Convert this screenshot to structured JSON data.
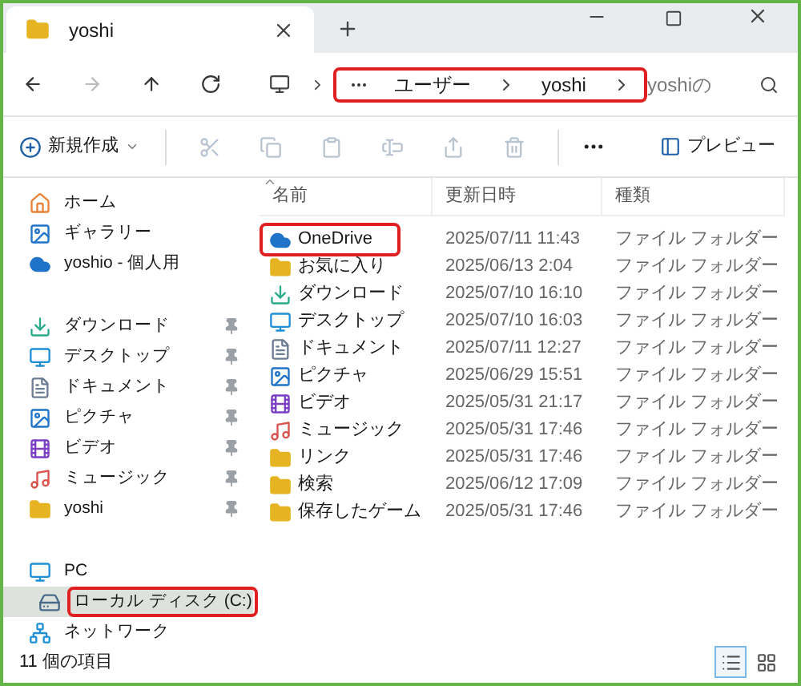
{
  "tab": {
    "title": "yoshi",
    "selected": true
  },
  "breadcrumb": {
    "segments": [
      "ユーザー",
      "yoshi"
    ],
    "annotated": true
  },
  "search": {
    "placeholder": "yoshiの"
  },
  "toolbar": {
    "new_label": "新規作成",
    "actions": [
      {
        "kind": "cut",
        "disabled": true
      },
      {
        "kind": "copy",
        "disabled": true
      },
      {
        "kind": "paste",
        "disabled": true
      },
      {
        "kind": "rename",
        "disabled": true
      },
      {
        "kind": "share",
        "disabled": true
      },
      {
        "kind": "delete",
        "disabled": true
      }
    ],
    "preview_label": "プレビュー"
  },
  "sidebar": {
    "groups": [
      [
        {
          "label": "ホーム",
          "kind": "home",
          "selected": false,
          "annotated": false
        },
        {
          "label": "ギャラリー",
          "kind": "picture",
          "selected": false,
          "annotated": false
        },
        {
          "label": "yoshio - 個人用",
          "kind": "cloud",
          "selected": false,
          "annotated": false
        }
      ],
      [
        {
          "label": "ダウンロード",
          "kind": "download",
          "pinned": true,
          "selected": false,
          "annotated": false
        },
        {
          "label": "デスクトップ",
          "kind": "desktop",
          "pinned": true,
          "selected": false,
          "annotated": false
        },
        {
          "label": "ドキュメント",
          "kind": "document",
          "pinned": true,
          "selected": false,
          "annotated": false
        },
        {
          "label": "ピクチャ",
          "kind": "picture",
          "pinned": true,
          "selected": false,
          "annotated": false
        },
        {
          "label": "ビデオ",
          "kind": "video",
          "pinned": true,
          "selected": false,
          "annotated": false
        },
        {
          "label": "ミュージック",
          "kind": "music",
          "pinned": true,
          "selected": false,
          "annotated": false
        },
        {
          "label": "yoshi",
          "kind": "folder",
          "pinned": true,
          "selected": false,
          "annotated": false
        }
      ],
      [
        {
          "label": "PC",
          "kind": "pc",
          "selected": false,
          "annotated": false,
          "children": [
            {
              "label": "ローカル ディスク (C:)",
              "kind": "drive",
              "selected": true,
              "annotated": true
            }
          ]
        },
        {
          "label": "ネットワーク",
          "kind": "network",
          "selected": false,
          "annotated": false
        }
      ]
    ]
  },
  "columns": [
    {
      "label": "名前",
      "sorted": true
    },
    {
      "label": "更新日時",
      "sorted": false
    },
    {
      "label": "種類",
      "sorted": false
    }
  ],
  "rows": [
    {
      "name": "OneDrive",
      "kind": "cloud",
      "modified": "2025/07/11 11:43",
      "type": "ファイル フォルダー",
      "annotated": true
    },
    {
      "name": "お気に入り",
      "kind": "folder",
      "modified": "2025/06/13 2:04",
      "type": "ファイル フォルダー",
      "annotated": false
    },
    {
      "name": "ダウンロード",
      "kind": "download",
      "modified": "2025/07/10 16:10",
      "type": "ファイル フォルダー",
      "annotated": false
    },
    {
      "name": "デスクトップ",
      "kind": "desktop",
      "modified": "2025/07/10 16:03",
      "type": "ファイル フォルダー",
      "annotated": false
    },
    {
      "name": "ドキュメント",
      "kind": "document",
      "modified": "2025/07/11 12:27",
      "type": "ファイル フォルダー",
      "annotated": false
    },
    {
      "name": "ピクチャ",
      "kind": "picture",
      "modified": "2025/06/29 15:51",
      "type": "ファイル フォルダー",
      "annotated": false
    },
    {
      "name": "ビデオ",
      "kind": "video",
      "modified": "2025/05/31 21:17",
      "type": "ファイル フォルダー",
      "annotated": false
    },
    {
      "name": "ミュージック",
      "kind": "music",
      "modified": "2025/05/31 17:46",
      "type": "ファイル フォルダー",
      "annotated": false
    },
    {
      "name": "リンク",
      "kind": "folder",
      "modified": "2025/05/31 17:46",
      "type": "ファイル フォルダー",
      "annotated": false
    },
    {
      "name": "検索",
      "kind": "folder",
      "modified": "2025/06/12 17:09",
      "type": "ファイル フォルダー",
      "annotated": false
    },
    {
      "name": "保存したゲーム",
      "kind": "folder",
      "modified": "2025/05/31 17:46",
      "type": "ファイル フォルダー",
      "annotated": false
    }
  ],
  "status": {
    "count": "11 個の項目",
    "views": [
      {
        "kind": "details",
        "selected": true
      },
      {
        "kind": "tiles",
        "selected": false
      }
    ]
  }
}
